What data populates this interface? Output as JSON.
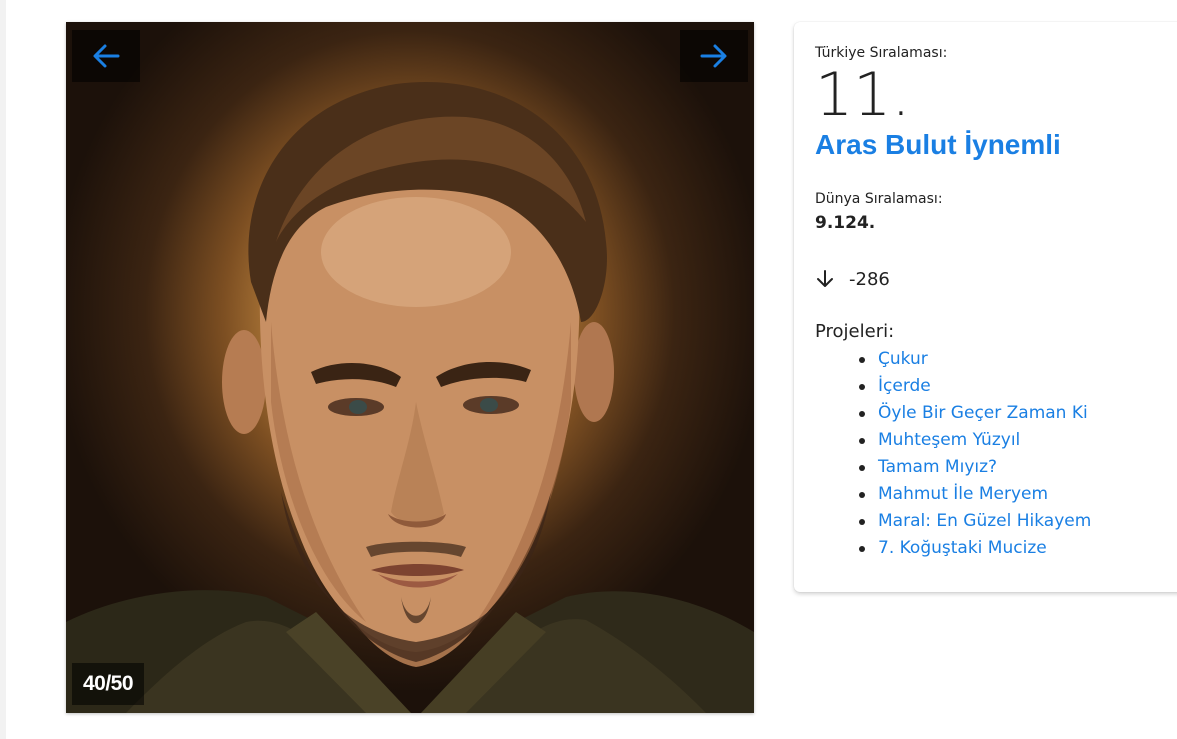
{
  "gallery": {
    "counter": "40/50",
    "prev_icon": "arrow-left-icon",
    "next_icon": "arrow-right-icon",
    "accent_color": "#1a7fe3"
  },
  "profile": {
    "turkey_rank_label": "Türkiye Sıralaması:",
    "turkey_rank": "11.",
    "name": "Aras Bulut İynemli",
    "world_rank_label": "Dünya Sıralaması:",
    "world_rank": "9.124.",
    "change_icon": "arrow-down-icon",
    "change_value": "-286",
    "projects_label": "Projeleri:",
    "projects": [
      "Çukur",
      "İçerde",
      "Öyle Bir Geçer Zaman Ki",
      "Muhteşem Yüzyıl",
      "Tamam Mıyız?",
      "Mahmut İle Meryem",
      "Maral: En Güzel Hikayem",
      "7. Koğuştaki Mucize"
    ]
  }
}
